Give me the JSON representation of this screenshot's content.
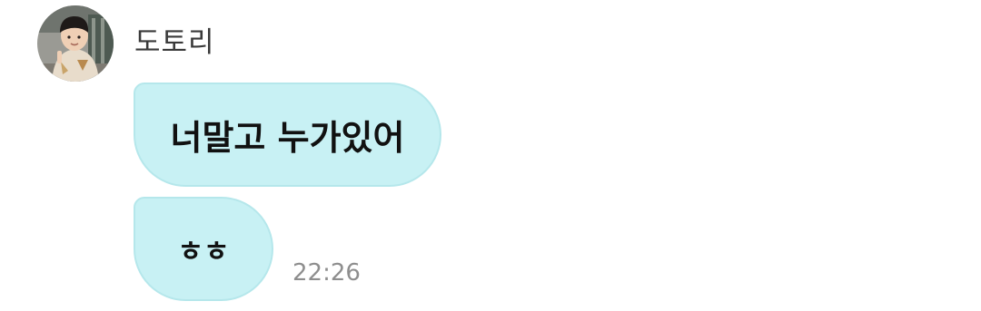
{
  "conversation": {
    "sender": {
      "name": "도토리"
    },
    "messages": [
      {
        "text": "너말고 누가있어"
      },
      {
        "text": "ㅎㅎ",
        "time": "22:26"
      }
    ]
  },
  "colors": {
    "bubble_fill": "#c8f1f4",
    "bubble_border": "#b5e7eb",
    "name_text": "#3a3a3a",
    "time_text": "#8e8e8e",
    "background": "#ffffff"
  }
}
